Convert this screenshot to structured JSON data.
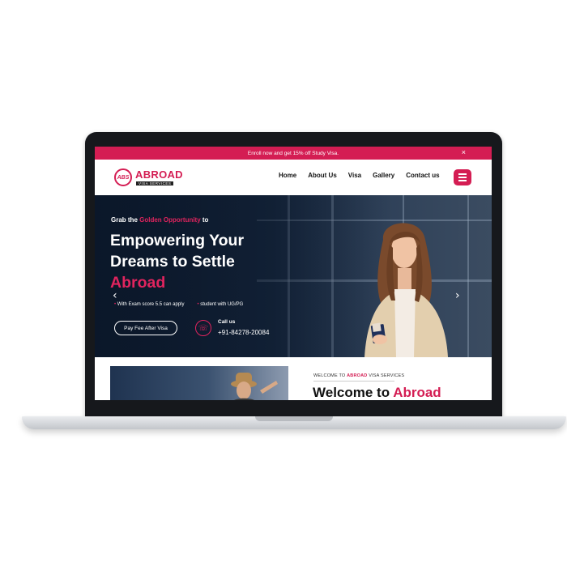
{
  "announcement": {
    "text": "Enroll now and get 15% off Study Visa.",
    "close": "×"
  },
  "logo": {
    "mark": "ABS",
    "word": "ABROAD",
    "sub": "VISA SERVICES"
  },
  "nav": {
    "items": [
      "Home",
      "About Us",
      "Visa",
      "Gallery",
      "Contact us"
    ]
  },
  "hero": {
    "pre_a": "Grab the ",
    "pre_highlight": "Golden Opportunity",
    "pre_b": " to",
    "title_line1": "Empowering Your",
    "title_line2": "Dreams to Settle",
    "title_highlight": "Abroad",
    "bullets": [
      "With Exam score 5.5 can apply",
      "student with UG/PG"
    ],
    "cta": "Pay Fee After Visa",
    "call_label": "Call us",
    "call_number": "+91-84278-20084",
    "prev": "‹",
    "next": "›"
  },
  "welcome": {
    "small_a": "WELCOME TO ",
    "small_highlight": "ABROAD",
    "small_b": " VISA SERVICES",
    "title_a": "Welcome to ",
    "title_highlight": "Abroad"
  },
  "colors": {
    "accent": "#d41d53",
    "hero_dark": "#0f1e32"
  }
}
